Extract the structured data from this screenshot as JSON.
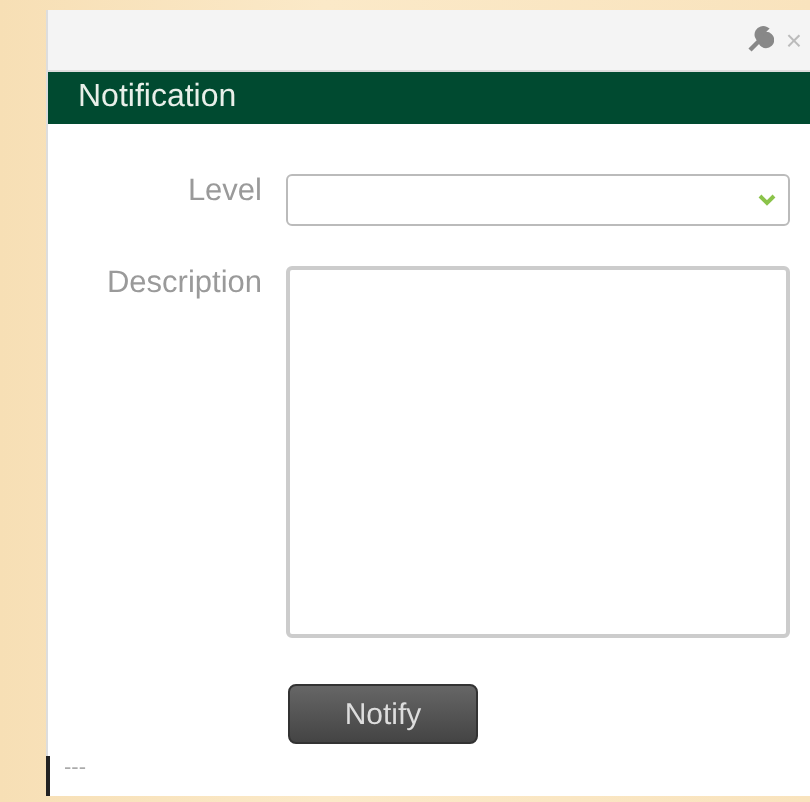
{
  "toolbar": {
    "close": "×"
  },
  "header": {
    "title": "Notification"
  },
  "form": {
    "level": {
      "label": "Level"
    },
    "description": {
      "label": "Description"
    }
  },
  "button": {
    "label": "Notify"
  },
  "footer": {
    "text": "---"
  }
}
